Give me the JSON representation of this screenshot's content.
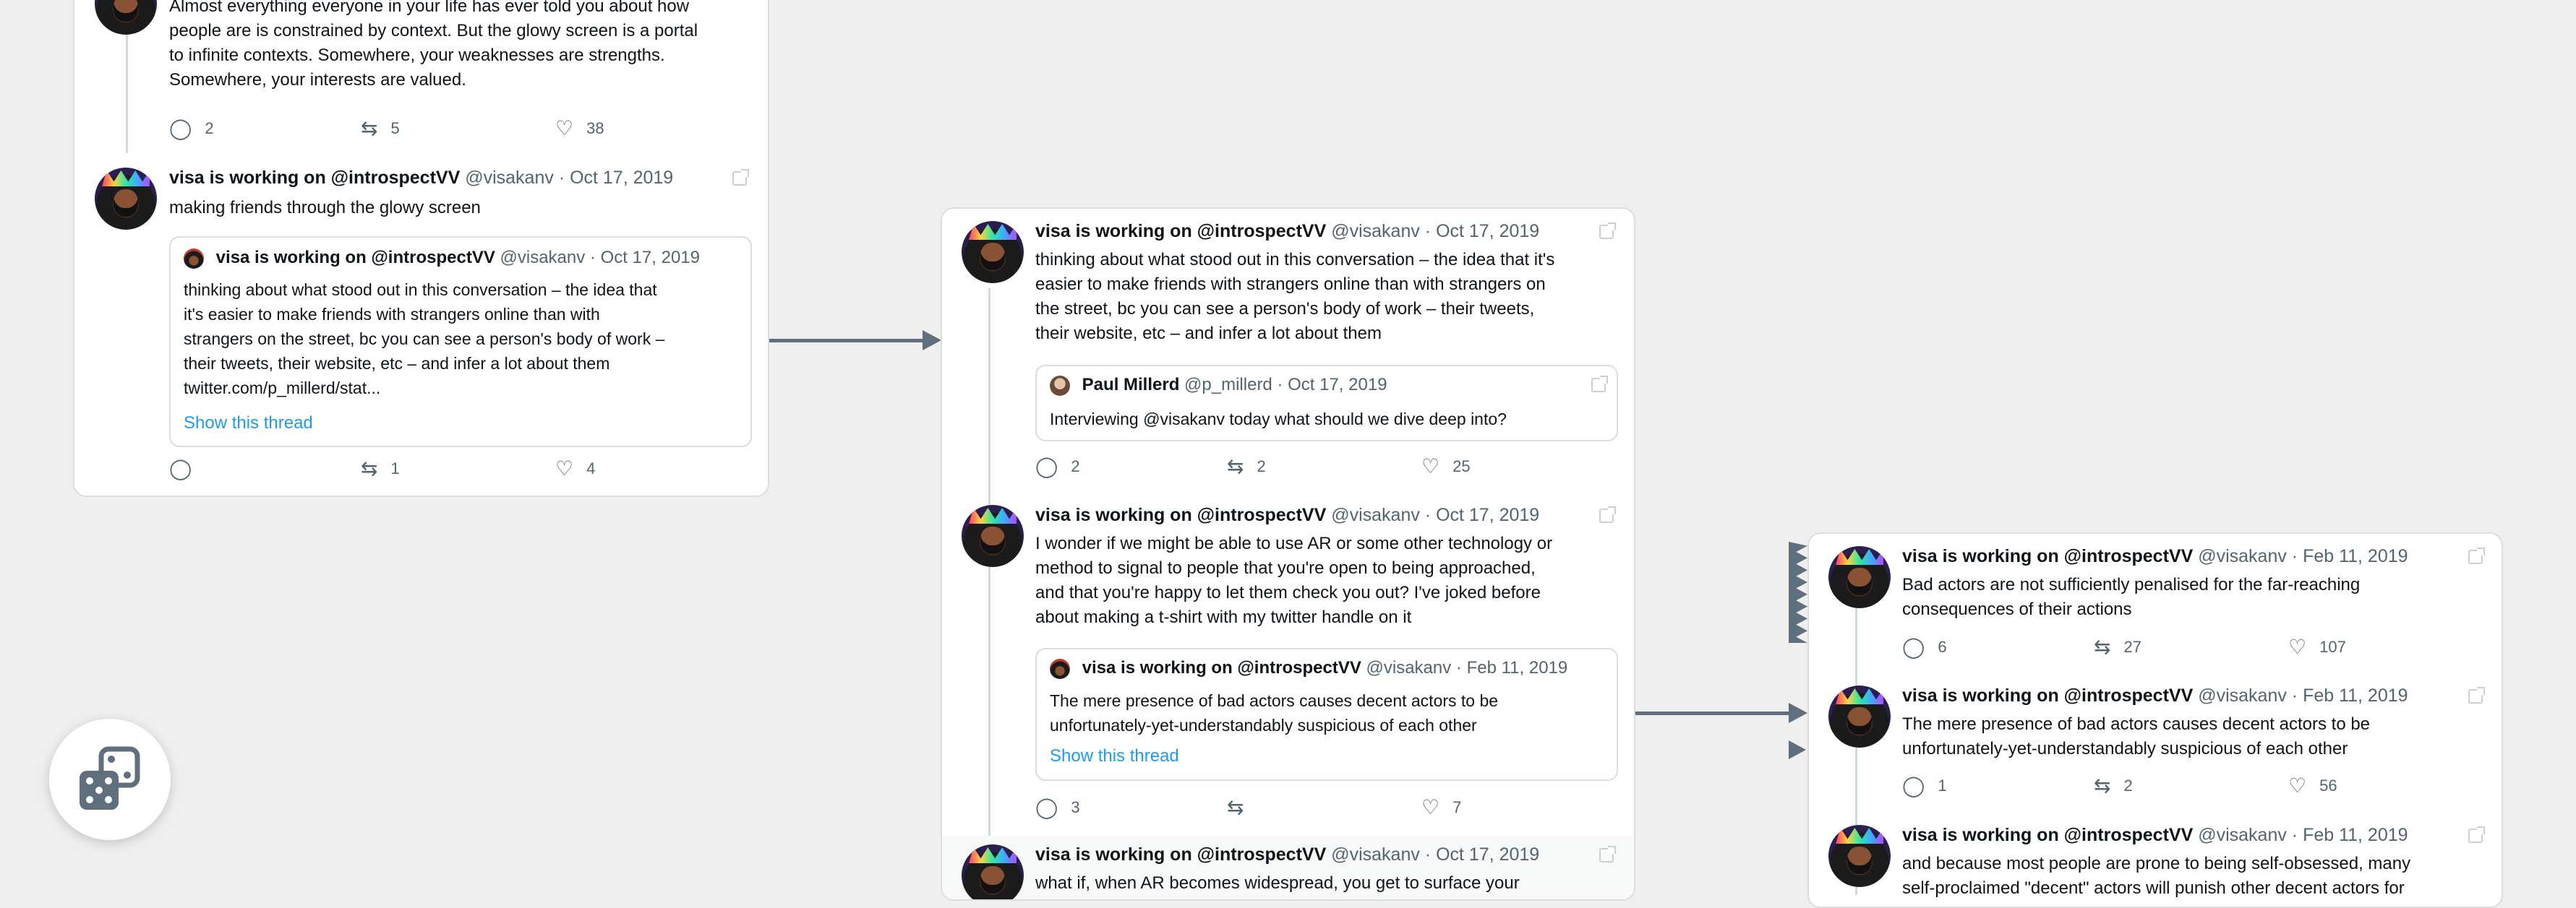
{
  "colors": {
    "background": "#efefef",
    "link": "#1d9bf0",
    "arrow": "#5f6f7d"
  },
  "card1": {
    "tweet_top": {
      "text_lines": [
        "Almost everything everyone in your life has ever told you about how",
        "people are is constrained by context. But the glowy screen is a portal",
        "to infinite contexts. Somewhere, your weaknesses are strengths.",
        "Somewhere, your interests are valued."
      ],
      "replies": "2",
      "retweets": "5",
      "likes": "38"
    },
    "tweet_main": {
      "name": "visa is working on @introspectVV",
      "meta": "@visakanv · Oct 17, 2019",
      "text": "making friends through the glowy screen",
      "quote": {
        "name": "visa is working on @introspectVV",
        "meta": "@visakanv · Oct 17, 2019",
        "text_lines": [
          "thinking about what stood out in this conversation – the idea that",
          "it's easier to make friends with strangers online than with",
          "strangers on the street, bc you can see a person's body of work –",
          "their tweets, their website, etc – and infer a lot about them",
          "twitter.com/p_millerd/stat..."
        ],
        "show_thread": "Show this thread"
      },
      "replies": "",
      "retweets": "1",
      "likes": "4"
    }
  },
  "card2": {
    "tweet1": {
      "name": "visa is working on @introspectVV",
      "meta": "@visakanv · Oct 17, 2019",
      "text_lines": [
        "thinking about what stood out in this conversation – the idea that it's",
        "easier to make friends with strangers online than with strangers on",
        "the street, bc you can see a person's body of work – their tweets,",
        "their website, etc – and infer a lot about them"
      ],
      "quote": {
        "name": "Paul Millerd",
        "meta": "@p_millerd · Oct 17, 2019",
        "text": "Interviewing @visakanv today what should we dive deep into?"
      },
      "replies": "2",
      "retweets": "2",
      "likes": "25"
    },
    "tweet2": {
      "name": "visa is working on @introspectVV",
      "meta": "@visakanv · Oct 17, 2019",
      "text_lines": [
        "I wonder if we might be able to use AR or some other technology or",
        "method to signal to people that you're open to being approached,",
        "and that you're happy to let them check you out? I've joked before",
        "about making a t-shirt with my twitter handle on it"
      ],
      "quote": {
        "name": "visa is working on @introspectVV",
        "meta": "@visakanv · Feb 11, 2019",
        "text_lines": [
          "The mere presence of bad actors causes decent actors to be",
          "unfortunately-yet-understandably suspicious of each other"
        ],
        "show_thread": "Show this thread"
      },
      "replies": "3",
      "retweets": "",
      "likes": "7"
    },
    "tweet3": {
      "name": "visa is working on @introspectVV",
      "meta": "@visakanv · Oct 17, 2019",
      "text": "what if, when AR becomes widespread, you get to surface your"
    }
  },
  "card3": {
    "tweet1": {
      "name": "visa is working on @introspectVV",
      "meta": "@visakanv · Feb 11, 2019",
      "text_lines": [
        "Bad actors are not sufficiently penalised for the far-reaching",
        "consequences of their actions"
      ],
      "replies": "6",
      "retweets": "27",
      "likes": "107"
    },
    "tweet2": {
      "name": "visa is working on @introspectVV",
      "meta": "@visakanv · Feb 11, 2019",
      "text_lines": [
        "The mere presence of bad actors causes decent actors to be",
        "unfortunately-yet-understandably suspicious of each other"
      ],
      "replies": "1",
      "retweets": "2",
      "likes": "56"
    },
    "tweet3": {
      "name": "visa is working on @introspectVV",
      "meta": "@visakanv · Feb 11, 2019",
      "text_lines": [
        "and because most people are prone to being self-obsessed, many",
        "self-proclaimed \"decent\" actors will punish other decent actors for"
      ]
    }
  },
  "icons": {
    "reply": "reply-icon",
    "retweet": "retweet-icon",
    "like": "heart-icon",
    "external": "external-link-icon",
    "random": "dice-icon"
  }
}
